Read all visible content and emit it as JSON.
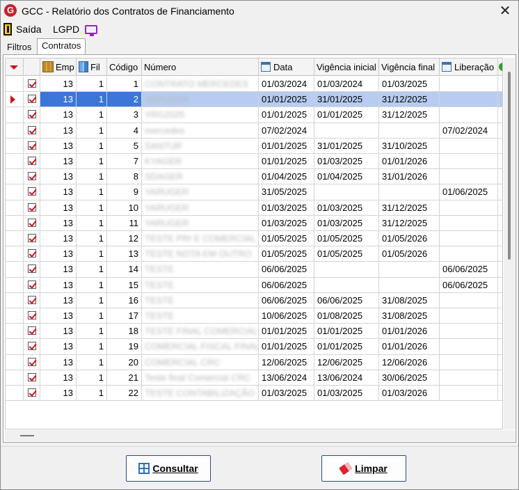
{
  "window": {
    "title": "GCC - Relatório dos Contratos de Financiamento",
    "close_glyph": "✕",
    "logo_letter": "G"
  },
  "toolbar": {
    "exit_label": "Saída",
    "lgpd_label": "LGPD"
  },
  "tabs": [
    {
      "label": "Filtros"
    },
    {
      "label": "Contratos"
    }
  ],
  "columns": {
    "emp": "Emp",
    "fil": "Fil",
    "codigo": "Código",
    "numero": "Número",
    "data": "Data",
    "vig_inicial": "Vigência inicial",
    "vig_final": "Vigência final",
    "liberacao": "Liberação"
  },
  "rows": [
    {
      "emp": "13",
      "fil": "1",
      "codigo": "1",
      "numero": "CONTRATO MERCEDES",
      "data": "01/03/2024",
      "vig_inicial": "01/03/2024",
      "vig_final": "01/03/2025",
      "liberacao": ""
    },
    {
      "emp": "13",
      "fil": "1",
      "codigo": "2",
      "numero": "YARUGER",
      "data": "01/01/2025",
      "vig_inicial": "31/01/2025",
      "vig_final": "31/12/2025",
      "liberacao": ""
    },
    {
      "emp": "13",
      "fil": "1",
      "codigo": "3",
      "numero": "YRG2025",
      "data": "01/01/2025",
      "vig_inicial": "01/01/2025",
      "vig_final": "31/12/2025",
      "liberacao": ""
    },
    {
      "emp": "13",
      "fil": "1",
      "codigo": "4",
      "numero": "mercedes",
      "data": "07/02/2024",
      "vig_inicial": "",
      "vig_final": "",
      "liberacao": "07/02/2024"
    },
    {
      "emp": "13",
      "fil": "1",
      "codigo": "5",
      "numero": "SANTUR",
      "data": "01/01/2025",
      "vig_inicial": "31/01/2025",
      "vig_final": "31/10/2025",
      "liberacao": ""
    },
    {
      "emp": "13",
      "fil": "1",
      "codigo": "7",
      "numero": "KYAGER",
      "data": "01/01/2025",
      "vig_inicial": "01/03/2025",
      "vig_final": "01/01/2026",
      "liberacao": ""
    },
    {
      "emp": "13",
      "fil": "1",
      "codigo": "8",
      "numero": "SDAGER",
      "data": "01/04/2025",
      "vig_inicial": "01/04/2025",
      "vig_final": "31/01/2026",
      "liberacao": ""
    },
    {
      "emp": "13",
      "fil": "1",
      "codigo": "9",
      "numero": "YARUGER",
      "data": "31/05/2025",
      "vig_inicial": "",
      "vig_final": "",
      "liberacao": "01/06/2025"
    },
    {
      "emp": "13",
      "fil": "1",
      "codigo": "10",
      "numero": "YARUGER",
      "data": "01/03/2025",
      "vig_inicial": "01/03/2025",
      "vig_final": "31/12/2025",
      "liberacao": ""
    },
    {
      "emp": "13",
      "fil": "1",
      "codigo": "11",
      "numero": "YARUGER",
      "data": "01/03/2025",
      "vig_inicial": "01/03/2025",
      "vig_final": "31/12/2025",
      "liberacao": ""
    },
    {
      "emp": "13",
      "fil": "1",
      "codigo": "12",
      "numero": "TESTE PRI E COMERCIAL",
      "data": "01/05/2025",
      "vig_inicial": "01/05/2025",
      "vig_final": "01/05/2026",
      "liberacao": ""
    },
    {
      "emp": "13",
      "fil": "1",
      "codigo": "13",
      "numero": "TESTE NOTA EM OUTRO",
      "data": "01/05/2025",
      "vig_inicial": "01/05/2025",
      "vig_final": "01/05/2026",
      "liberacao": ""
    },
    {
      "emp": "13",
      "fil": "1",
      "codigo": "14",
      "numero": "TESTE",
      "data": "06/06/2025",
      "vig_inicial": "",
      "vig_final": "",
      "liberacao": "06/06/2025"
    },
    {
      "emp": "13",
      "fil": "1",
      "codigo": "15",
      "numero": "TESTE",
      "data": "06/06/2025",
      "vig_inicial": "",
      "vig_final": "",
      "liberacao": "06/06/2025"
    },
    {
      "emp": "13",
      "fil": "1",
      "codigo": "16",
      "numero": "TESTE",
      "data": "06/06/2025",
      "vig_inicial": "06/06/2025",
      "vig_final": "31/08/2025",
      "liberacao": ""
    },
    {
      "emp": "13",
      "fil": "1",
      "codigo": "17",
      "numero": "TESTE",
      "data": "10/06/2025",
      "vig_inicial": "01/08/2025",
      "vig_final": "31/08/2025",
      "liberacao": ""
    },
    {
      "emp": "13",
      "fil": "1",
      "codigo": "18",
      "numero": "TESTE FINAL COMERCIAL",
      "data": "01/01/2025",
      "vig_inicial": "01/01/2025",
      "vig_final": "01/01/2026",
      "liberacao": ""
    },
    {
      "emp": "13",
      "fil": "1",
      "codigo": "19",
      "numero": "COMERCIAL FISCAL FINAL",
      "data": "01/01/2025",
      "vig_inicial": "01/01/2025",
      "vig_final": "01/01/2026",
      "liberacao": ""
    },
    {
      "emp": "13",
      "fil": "1",
      "codigo": "20",
      "numero": "COMERCIAL CRC",
      "data": "12/06/2025",
      "vig_inicial": "12/06/2025",
      "vig_final": "12/06/2026",
      "liberacao": ""
    },
    {
      "emp": "13",
      "fil": "1",
      "codigo": "21",
      "numero": "Teste final Comercial CRC",
      "data": "13/06/2024",
      "vig_inicial": "13/06/2024",
      "vig_final": "30/06/2025",
      "liberacao": ""
    },
    {
      "emp": "13",
      "fil": "1",
      "codigo": "22",
      "numero": "TESTE CONTABILIZAÇÃO",
      "data": "01/03/2025",
      "vig_inicial": "01/03/2025",
      "vig_final": "01/03/2026",
      "liberacao": ""
    }
  ],
  "selected_row_index": 1,
  "buttons": {
    "consultar": "Consultar",
    "limpar": "Limpar"
  },
  "colors": {
    "selection": "#3b76d8",
    "selection_light": "#b7ccf0",
    "check": "#d0101a",
    "logo": "#c8202a"
  },
  "icons": {
    "exit": "exit-door-icon",
    "lgpd": "monitor-icon",
    "emp": "company-icon",
    "fil": "branch-icon",
    "date": "calendar-icon",
    "consultar": "grid-search-icon",
    "limpar": "eraser-icon"
  }
}
